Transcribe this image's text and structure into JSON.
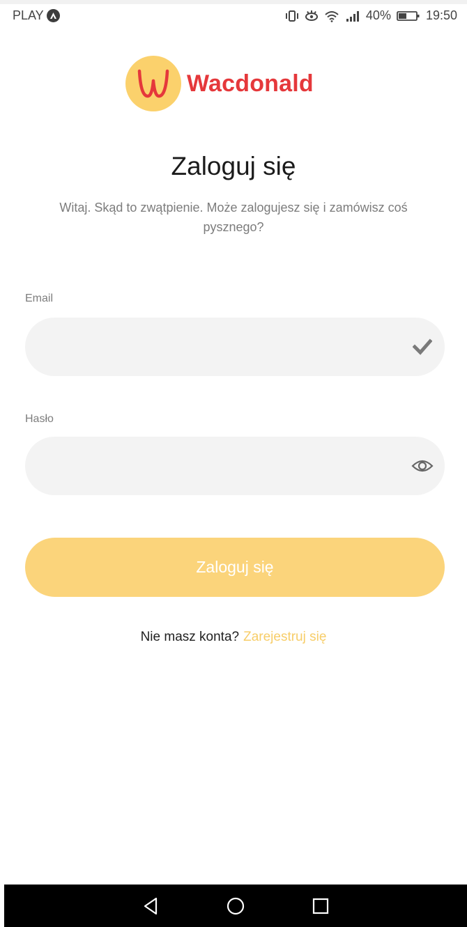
{
  "status_bar": {
    "carrier": "PLAY",
    "battery": "40%",
    "time": "19:50"
  },
  "brand": {
    "logo_letter": "W",
    "name": "Wacdonald",
    "colors": {
      "primary": "#e5383b",
      "accent": "#fbd16c"
    }
  },
  "login": {
    "title": "Zaloguj się",
    "subtitle": "Witaj. Skąd to zwątpienie. Może zalogujesz się i zamówisz coś pysznego?",
    "email": {
      "label": "Email",
      "value": "",
      "icon": "checkmark-icon"
    },
    "password": {
      "label": "Hasło",
      "value": "",
      "icon": "eye-icon"
    },
    "submit_label": "Zaloguj się",
    "register_prompt": "Nie masz konta?",
    "register_link": "Zarejestruj się"
  },
  "nav_bar": {
    "icons": [
      "back-icon",
      "home-icon",
      "recents-icon"
    ]
  }
}
